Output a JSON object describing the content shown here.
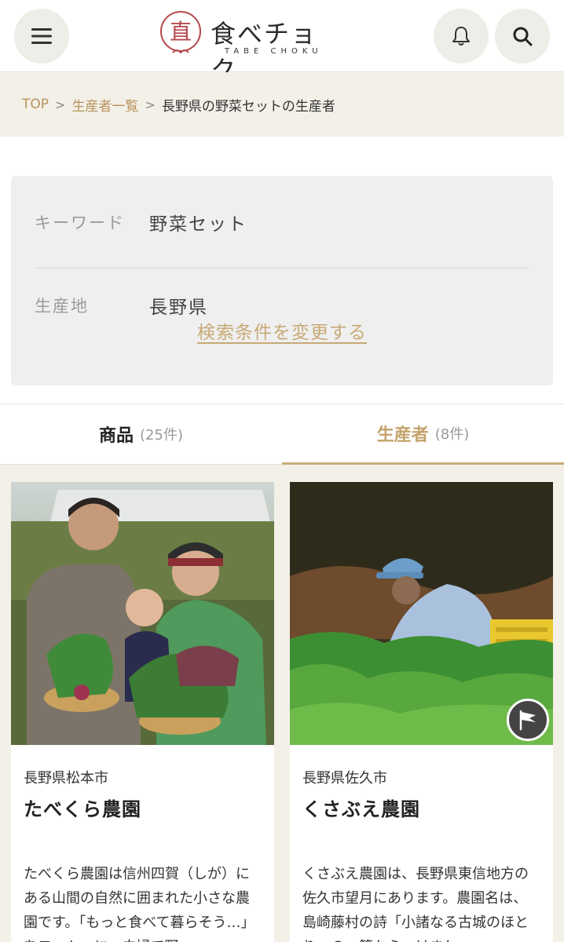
{
  "header": {
    "logo_text": "食べチョク",
    "logo_sub": "TABE CHOKU",
    "logo_seal": "直",
    "menu_icon": "menu-icon",
    "notification_icon": "bell-icon",
    "search_icon": "search-icon"
  },
  "breadcrumb": {
    "items": [
      "TOP",
      "生産者一覧"
    ],
    "current": "長野県の野菜セットの生産者",
    "separator": ">"
  },
  "conditions": {
    "keyword_label": "キーワード",
    "keyword_value": "野菜セット",
    "region_label": "生産地",
    "region_value": "長野県",
    "change_link": "検索条件を変更する"
  },
  "tabs": [
    {
      "label": "商品",
      "count": "(25件)",
      "active": false
    },
    {
      "label": "生産者",
      "count": "(8件)",
      "active": true
    }
  ],
  "producers": [
    {
      "location": "長野県松本市",
      "name": "たべくら農園",
      "description": "たべくら農園は信州四賀（しが）にある山間の自然に囲まれた小さな農園です。「もっと食べて暮らそう…」をモットーに、夫婦で野"
    },
    {
      "location": "長野県佐久市",
      "name": "くさぶえ農園",
      "description": "くさぶえ農園は、長野県東信地方の佐久市望月にあります。農園名は、島崎藤村の詩「小諸なる古城のほとり」の一節からつけまし"
    }
  ],
  "colors": {
    "accent": "#c4a36a",
    "link": "#b8925a",
    "background": "#f3f0e8"
  }
}
